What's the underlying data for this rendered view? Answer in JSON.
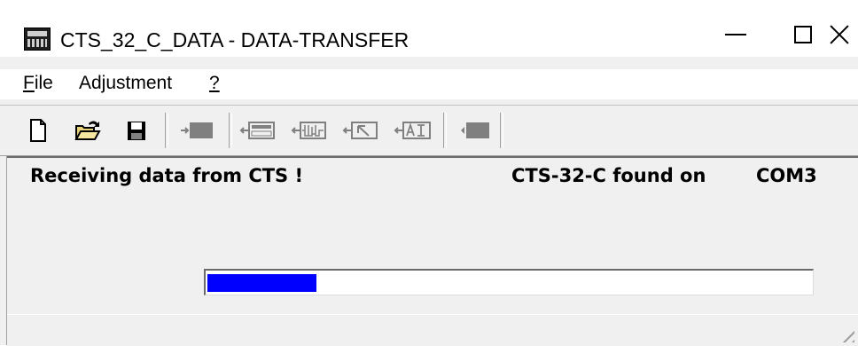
{
  "window": {
    "title": "CTS_32_C_DATA - DATA-TRANSFER",
    "icon": "terminal-keyboard-icon"
  },
  "menu": {
    "file": {
      "mnemonic": "F",
      "rest": "ile"
    },
    "adjustment": "Adjustment",
    "help": "?"
  },
  "toolbar": {
    "icons": [
      "new-file-icon",
      "open-folder-icon",
      "save-disk-icon",
      "send-to-device-icon",
      "receive-data-icon",
      "receive-waveform-icon",
      "receive-cursor-icon",
      "receive-analog-icon",
      "device-info-icon"
    ]
  },
  "status": {
    "receiving": "Receiving data from CTS !",
    "found_on": "CTS-32-C found on",
    "port": "COM3"
  },
  "progress": {
    "fraction": 0.18,
    "color": "#0000ff"
  }
}
